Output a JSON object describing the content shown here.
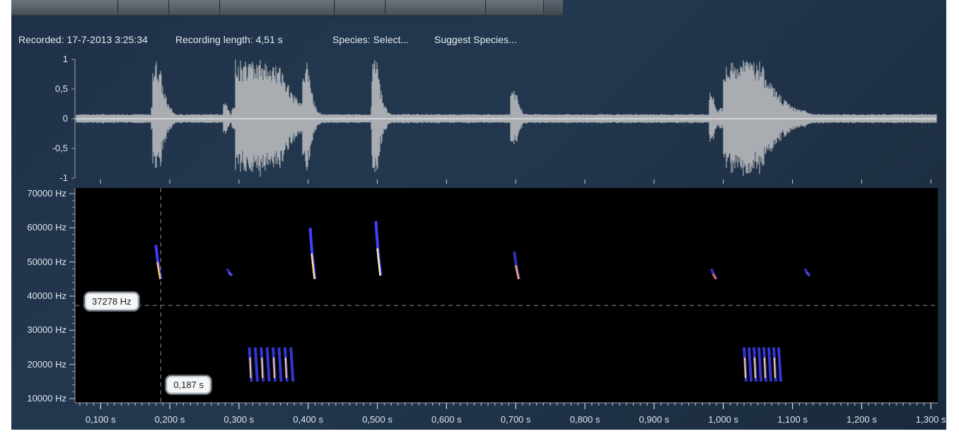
{
  "info": {
    "recorded": "Recorded: 17-7-2013 3:25:34",
    "recording_length": "Recording length: 4,51 s",
    "species": "Species: Select...",
    "suggest": "Suggest Species..."
  },
  "waveform": {
    "y_ticks": [
      "1",
      "0,5",
      "0",
      "-0,5",
      "-1"
    ],
    "y_values": [
      1,
      0.5,
      0,
      -0.5,
      -1
    ]
  },
  "spectrogram": {
    "y_ticks": [
      "70000 Hz",
      "60000 Hz",
      "50000 Hz",
      "40000 Hz",
      "30000 Hz",
      "20000 Hz",
      "10000 Hz"
    ],
    "y_values": [
      70000,
      60000,
      50000,
      40000,
      30000,
      20000,
      10000
    ],
    "x_ticks": [
      "0,100 s",
      "0,200 s",
      "0,300 s",
      "0,400 s",
      "0,500 s",
      "0,600 s",
      "0,700 s",
      "0,800 s",
      "0,900 s",
      "1,000 s",
      "1,100 s",
      "1,200 s",
      "1,300 s"
    ],
    "x_values": [
      0.1,
      0.2,
      0.3,
      0.4,
      0.5,
      0.6,
      0.7,
      0.8,
      0.9,
      1.0,
      1.1,
      1.2,
      1.3
    ],
    "cursor_freq_label": "37278 Hz",
    "cursor_time_label": "0,187 s",
    "cursor_freq": 37278,
    "cursor_time": 0.187
  },
  "colors": {
    "background": "#1f3148",
    "waveform": "#a9adb2",
    "spectrogram_bg": "#000000"
  }
}
